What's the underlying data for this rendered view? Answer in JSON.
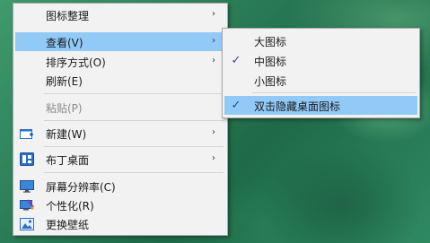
{
  "main_menu": {
    "items": [
      {
        "label": "图标整理",
        "submenu": true
      },
      {
        "label": "查看(V)",
        "submenu": true
      },
      {
        "label": "排序方式(O)",
        "submenu": true
      },
      {
        "label": "刷新(E)"
      },
      {
        "label": "粘贴(P)",
        "disabled": true
      },
      {
        "label": "新建(W)",
        "submenu": true,
        "icon": "new-document-icon"
      },
      {
        "label": "布丁桌面",
        "submenu": true,
        "icon": "grid-app-icon"
      },
      {
        "label": "屏幕分辨率(C)",
        "icon": "monitor-icon"
      },
      {
        "label": "个性化(R)",
        "icon": "personalize-icon"
      },
      {
        "label": "更换壁纸",
        "icon": "picture-icon"
      }
    ]
  },
  "view_submenu": {
    "items": [
      {
        "label": "大图标",
        "checked": false
      },
      {
        "label": "中图标",
        "checked": true
      },
      {
        "label": "小图标",
        "checked": false
      },
      {
        "label": "双击隐藏桌面图标",
        "checked": true
      }
    ]
  },
  "glyphs": {
    "arrow": "›",
    "check": "✓"
  },
  "colors": {
    "highlight": "#91c9f7",
    "menu_bg": "#f2f2f2",
    "accent": "#1f4e9a"
  }
}
